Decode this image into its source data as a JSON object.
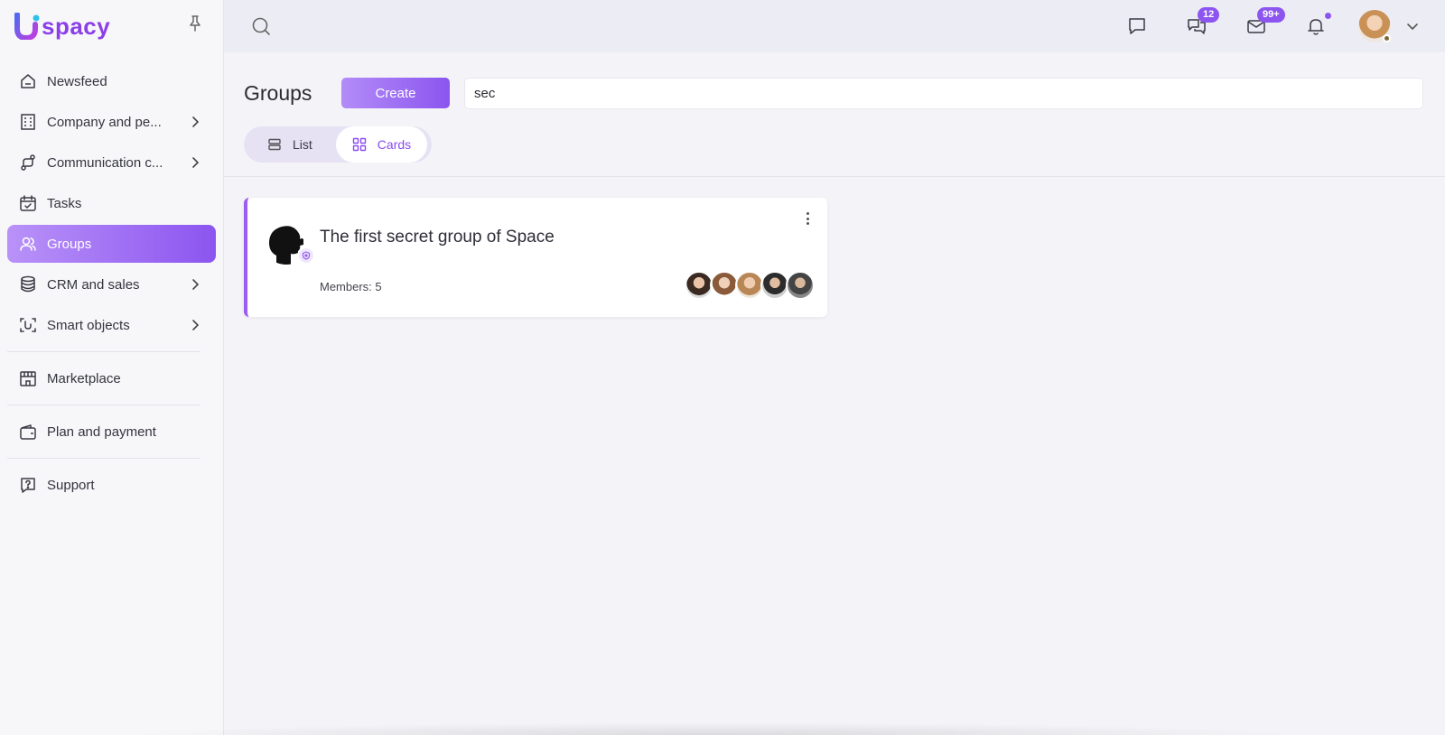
{
  "app": {
    "logo_text": "spacy"
  },
  "colors": {
    "accent": "#8c55f0",
    "accent_light": "#b992f8"
  },
  "sidebar": {
    "items": [
      {
        "label": "Newsfeed",
        "icon": "home-icon"
      },
      {
        "label": "Company and pe...",
        "icon": "building-icon"
      },
      {
        "label": "Communication c...",
        "icon": "route-icon"
      },
      {
        "label": "Tasks",
        "icon": "calendar-icon"
      },
      {
        "label": "Groups",
        "icon": "users-icon",
        "active": true
      },
      {
        "label": "CRM and sales",
        "icon": "database-icon"
      },
      {
        "label": "Smart objects",
        "icon": "scan-icon"
      },
      {
        "label": "Marketplace",
        "icon": "store-icon"
      },
      {
        "label": "Plan and payment",
        "icon": "wallet-icon"
      },
      {
        "label": "Support",
        "icon": "question-icon"
      }
    ]
  },
  "topbar": {
    "chat_badge": "12",
    "mail_badge": "99+"
  },
  "header": {
    "title": "Groups",
    "create_label": "Create",
    "search_value": "sec",
    "view_list": "List",
    "view_cards": "Cards",
    "active_view": "Cards"
  },
  "groups": [
    {
      "title": "The first secret group of Space",
      "members_text": "Members: 5"
    }
  ]
}
